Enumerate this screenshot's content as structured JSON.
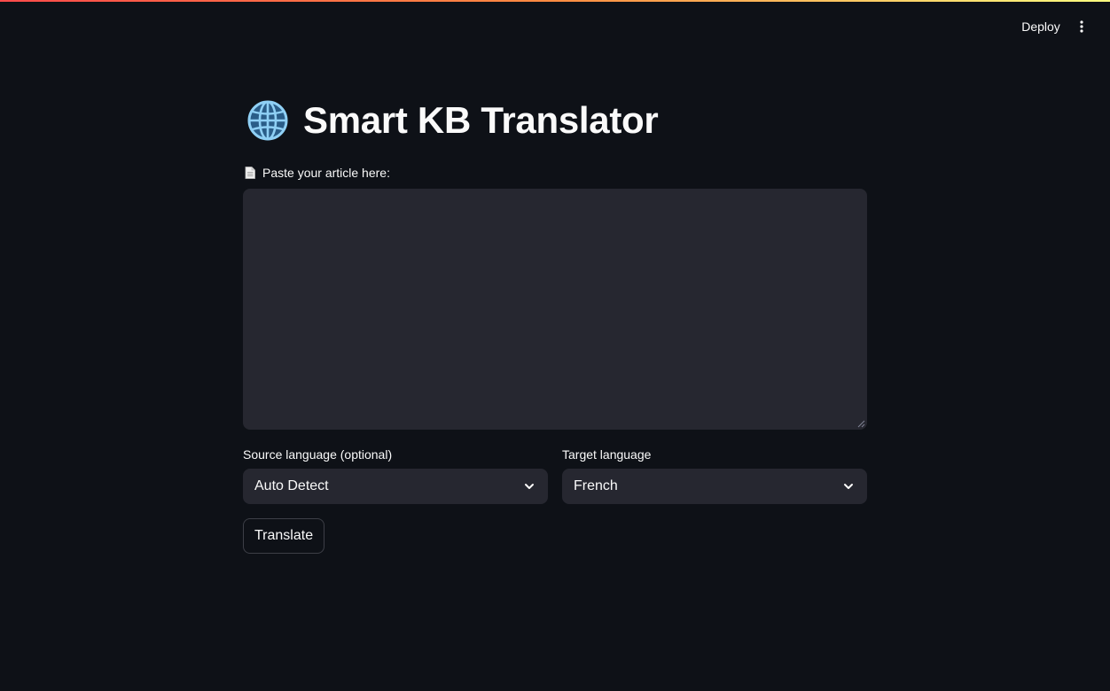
{
  "header": {
    "deploy_label": "Deploy",
    "menu_icon": "vertical-ellipsis-icon"
  },
  "main": {
    "title_icon": "globe-icon",
    "title": "Smart KB Translator",
    "article_label_icon": "document-icon",
    "article_label": "Paste your article here:",
    "article_value": "",
    "source": {
      "label": "Source language (optional)",
      "selected": "Auto Detect"
    },
    "target": {
      "label": "Target language",
      "selected": "French"
    },
    "translate_label": "Translate"
  },
  "colors": {
    "background": "#0e1117",
    "input_bg": "#262730",
    "text": "#fafafa",
    "globe": "#7fc4f0"
  }
}
